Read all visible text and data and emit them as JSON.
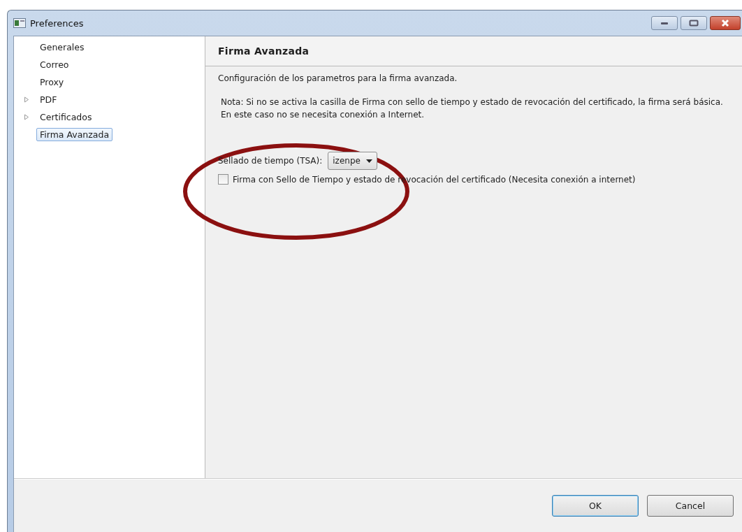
{
  "window": {
    "title": "Preferences"
  },
  "sidebar": {
    "items": [
      {
        "label": "Generales",
        "kind": "leaf",
        "selected": false
      },
      {
        "label": "Correo",
        "kind": "leaf",
        "selected": false
      },
      {
        "label": "Proxy",
        "kind": "leaf",
        "selected": false
      },
      {
        "label": "PDF",
        "kind": "branch",
        "expanded": false,
        "selected": false
      },
      {
        "label": "Certificados",
        "kind": "branch",
        "expanded": false,
        "selected": false
      },
      {
        "label": "Firma Avanzada",
        "kind": "leaf",
        "selected": true
      }
    ]
  },
  "page": {
    "title": "Firma Avanzada",
    "description": "Configuración de los parametros para la firma avanzada.",
    "note": "Nota: Si no se activa la casilla de Firma con sello de tiempo y estado de revocación del certificado, la firma será básica. En este caso no se necesita conexión a Internet.",
    "tsa": {
      "label": "Sellado de tiempo (TSA):",
      "value": "izenpe"
    },
    "timestamp_checkbox": {
      "label": "Firma con Sello de Tiempo y estado de revocación del certificado (Necesita conexión a internet)",
      "checked": false
    }
  },
  "buttons": [
    {
      "label": "OK",
      "kind": "default"
    },
    {
      "label": "Cancel",
      "kind": "normal"
    }
  ]
}
